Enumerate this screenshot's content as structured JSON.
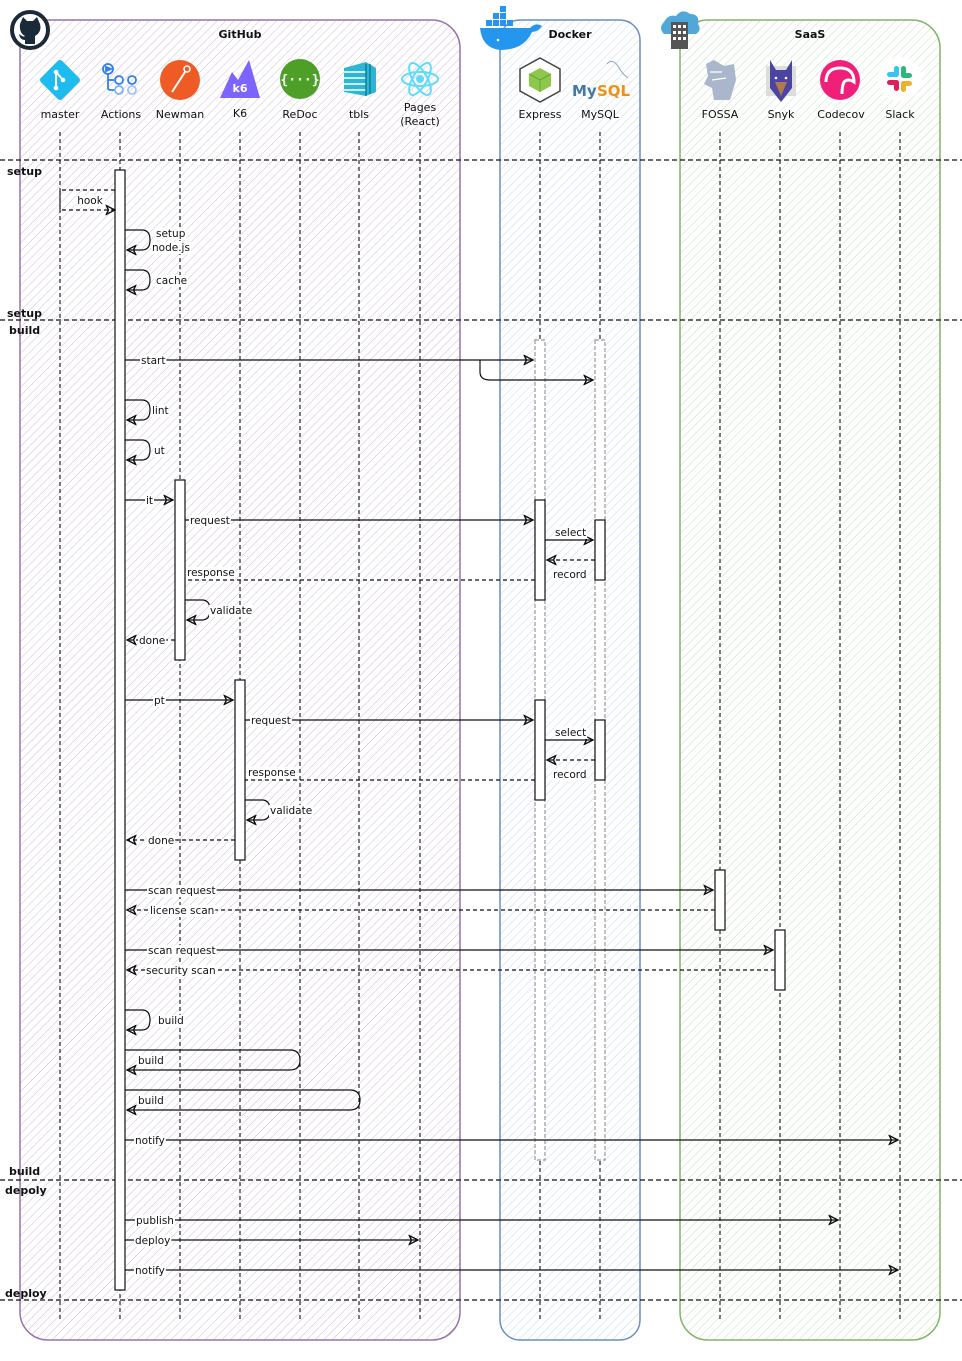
{
  "groups": [
    {
      "id": "github",
      "title": "GitHub",
      "icon": "github-icon",
      "border": "#9673a6",
      "fill": "#e1d5e7"
    },
    {
      "id": "docker",
      "title": "Docker",
      "icon": "docker-whale-icon",
      "border": "#6c8ebf",
      "fill": "#dae8fc"
    },
    {
      "id": "saas",
      "title": "SaaS",
      "icon": "cloud-building-icon",
      "border": "#82b366",
      "fill": "#d5e8d4"
    }
  ],
  "participants": [
    {
      "id": "master",
      "label": "master",
      "group": "github",
      "icon": "git-icon",
      "color": "#1ebbee"
    },
    {
      "id": "actions",
      "label": "Actions",
      "group": "github",
      "icon": "github-actions-icon",
      "color": "#2f80ed"
    },
    {
      "id": "newman",
      "label": "Newman",
      "group": "github",
      "icon": "postman-icon",
      "color": "#ef5b25"
    },
    {
      "id": "k6",
      "label": "K6",
      "group": "github",
      "icon": "k6-icon",
      "color": "#7d64ff"
    },
    {
      "id": "redoc",
      "label": "ReDoc",
      "group": "github",
      "icon": "openapi-braces-icon",
      "color": "#4d9f28"
    },
    {
      "id": "tbls",
      "label": "tbls",
      "group": "github",
      "icon": "tbls-layers-icon",
      "color": "#1a9bb8"
    },
    {
      "id": "pages",
      "label": "Pages",
      "label2": "(React)",
      "group": "github",
      "icon": "react-icon",
      "color": "#61dafb"
    },
    {
      "id": "express",
      "label": "Express",
      "group": "docker",
      "icon": "node-cube-icon",
      "color": "#8cc84b"
    },
    {
      "id": "mysql",
      "label": "MySQL",
      "group": "docker",
      "icon": "mysql-dolphin-icon",
      "color": "#4479a1"
    },
    {
      "id": "fossa",
      "label": "FOSSA",
      "group": "saas",
      "icon": "fossa-icon",
      "color": "#8b9bb5"
    },
    {
      "id": "snyk",
      "label": "Snyk",
      "group": "saas",
      "icon": "snyk-dog-icon",
      "color": "#4b45a1"
    },
    {
      "id": "codecov",
      "label": "Codecov",
      "group": "saas",
      "icon": "codecov-umbrella-icon",
      "color": "#f01f7a"
    },
    {
      "id": "slack",
      "label": "Slack",
      "group": "saas",
      "icon": "slack-icon",
      "color": "#e01e5a"
    }
  ],
  "phases": [
    {
      "start_label": "setup",
      "end_label": "setup"
    },
    {
      "start_label": "build",
      "end_label": "build"
    },
    {
      "start_label": "depoly",
      "end_label": "deploy"
    }
  ],
  "messages": [
    {
      "label": "hook",
      "from": "master",
      "to": "actions",
      "style": "dashed-loop"
    },
    {
      "label": "setup",
      "label2": "node.js",
      "from": "actions",
      "to": "actions",
      "style": "self"
    },
    {
      "label": "cache",
      "from": "actions",
      "to": "actions",
      "style": "self"
    },
    {
      "label": "start",
      "from": "actions",
      "to": "express",
      "style": "solid",
      "also_to": "mysql"
    },
    {
      "label": "lint",
      "from": "actions",
      "to": "actions",
      "style": "self"
    },
    {
      "label": "ut",
      "from": "actions",
      "to": "actions",
      "style": "self"
    },
    {
      "label": "it",
      "from": "actions",
      "to": "newman",
      "style": "solid"
    },
    {
      "label": "request",
      "from": "newman",
      "to": "express",
      "style": "solid"
    },
    {
      "label": "select",
      "from": "express",
      "to": "mysql",
      "style": "solid"
    },
    {
      "label": "record",
      "from": "mysql",
      "to": "express",
      "style": "dashed"
    },
    {
      "label": "response",
      "from": "express",
      "to": "newman",
      "style": "dashed"
    },
    {
      "label": "validate",
      "from": "newman",
      "to": "newman",
      "style": "self"
    },
    {
      "label": "done",
      "from": "newman",
      "to": "actions",
      "style": "dashed"
    },
    {
      "label": "pt",
      "from": "actions",
      "to": "k6",
      "style": "solid"
    },
    {
      "label": "request",
      "from": "k6",
      "to": "express",
      "style": "solid"
    },
    {
      "label": "select",
      "from": "express",
      "to": "mysql",
      "style": "solid"
    },
    {
      "label": "record",
      "from": "mysql",
      "to": "express",
      "style": "dashed"
    },
    {
      "label": "response",
      "from": "express",
      "to": "k6",
      "style": "dashed"
    },
    {
      "label": "validate",
      "from": "k6",
      "to": "k6",
      "style": "self"
    },
    {
      "label": "done",
      "from": "k6",
      "to": "actions",
      "style": "dashed"
    },
    {
      "label": "scan request",
      "from": "actions",
      "to": "fossa",
      "style": "solid"
    },
    {
      "label": "license scan",
      "from": "fossa",
      "to": "actions",
      "style": "dashed"
    },
    {
      "label": "scan request",
      "from": "actions",
      "to": "snyk",
      "style": "solid"
    },
    {
      "label": "security scan",
      "from": "snyk",
      "to": "actions",
      "style": "dashed"
    },
    {
      "label": "build",
      "from": "actions",
      "to": "actions",
      "style": "self"
    },
    {
      "label": "build",
      "from": "actions",
      "to": "redoc",
      "style": "roundtrip"
    },
    {
      "label": "build",
      "from": "actions",
      "to": "tbls",
      "style": "roundtrip"
    },
    {
      "label": "notify",
      "from": "actions",
      "to": "slack",
      "style": "solid"
    },
    {
      "label": "publish",
      "from": "actions",
      "to": "codecov",
      "style": "solid"
    },
    {
      "label": "deploy",
      "from": "actions",
      "to": "pages",
      "style": "solid"
    },
    {
      "label": "notify",
      "from": "actions",
      "to": "slack",
      "style": "solid"
    }
  ]
}
